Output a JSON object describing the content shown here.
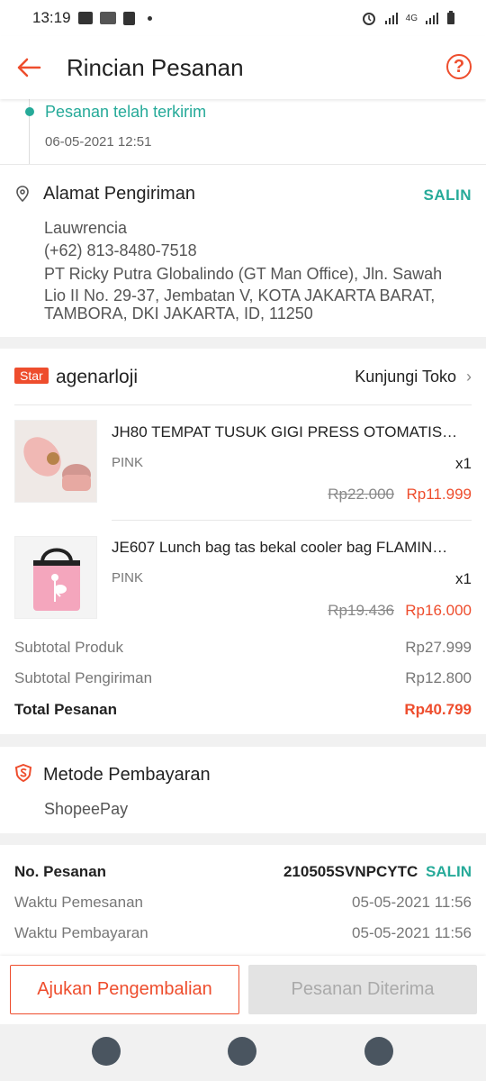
{
  "status_bar": {
    "time": "13:19",
    "network": "4G"
  },
  "header": {
    "title": "Rincian Pesanan",
    "help_glyph": "?"
  },
  "shipment": {
    "status": "Pesanan telah terkirim",
    "datetime": "06-05-2021 12:51"
  },
  "address": {
    "title": "Alamat Pengiriman",
    "copy_label": "SALIN",
    "name": "Lauwrencia",
    "phone": "(+62) 813-8480-7518",
    "line1": "PT Ricky Putra Globalindo (GT Man Office), Jln. Sawah",
    "line2": "Lio II No. 29-37, Jembatan V, KOTA JAKARTA BARAT,",
    "line3": "TAMBORA, DKI JAKARTA, ID, 11250"
  },
  "shop": {
    "badge": "Star",
    "name": "agenarloji",
    "visit_label": "Kunjungi Toko"
  },
  "products": [
    {
      "name": "JH80 TEMPAT TUSUK GIGI PRESS OTOMATIS…",
      "variant": "PINK",
      "qty": "x1",
      "old_price": "Rp22.000",
      "price": "Rp11.999"
    },
    {
      "name": "JE607 Lunch bag tas bekal cooler bag FLAMIN…",
      "variant": "PINK",
      "qty": "x1",
      "old_price": "Rp19.436",
      "price": "Rp16.000"
    }
  ],
  "totals": {
    "subtotal_product_label": "Subtotal Produk",
    "subtotal_product": "Rp27.999",
    "subtotal_shipping_label": "Subtotal Pengiriman",
    "subtotal_shipping": "Rp12.800",
    "total_label": "Total Pesanan",
    "total": "Rp40.799"
  },
  "payment": {
    "title": "Metode Pembayaran",
    "method": "ShopeePay"
  },
  "order": {
    "no_label": "No. Pesanan",
    "no": "210505SVNPCYTC",
    "copy_label": "SALIN",
    "order_time_label": "Waktu Pemesanan",
    "order_time": "05-05-2021 11:56",
    "pay_time_label": "Waktu Pembayaran",
    "pay_time": "05-05-2021 11:56"
  },
  "actions": {
    "return_label": "Ajukan Pengembalian",
    "received_label": "Pesanan Diterima"
  },
  "colors": {
    "accent": "#ee4d2d",
    "teal": "#26aa99"
  }
}
